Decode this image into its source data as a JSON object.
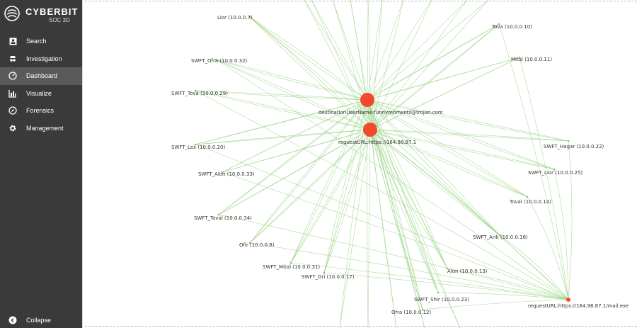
{
  "app": {
    "brand": "CYBERBIT",
    "product": "SOC 3D"
  },
  "sidebar": {
    "items": [
      {
        "label": "Search",
        "icon": "contact-card-icon"
      },
      {
        "label": "Investigation",
        "icon": "spy-icon"
      },
      {
        "label": "Dashboard",
        "icon": "speedometer-icon",
        "active": true
      },
      {
        "label": "Visualize",
        "icon": "bar-chart-icon"
      },
      {
        "label": "Forensics",
        "icon": "compass-icon"
      },
      {
        "label": "Management",
        "icon": "gear-icon"
      }
    ],
    "collapse_label": "Collapse"
  },
  "graph": {
    "edge_color": "#8fcf7a",
    "node_color": "#f24a2b",
    "hubs": [
      {
        "id": "hub1",
        "label": "destinationUserName:funnymoments@trojan.com"
      },
      {
        "id": "hub2",
        "label": "requestURL:https://164.98.87.1"
      },
      {
        "id": "hub3",
        "label": "requestURL:https://164.98.87.1/mail.exe"
      }
    ],
    "nodes": [
      {
        "id": "n1",
        "label": "Lior (10.0.0.7)"
      },
      {
        "id": "n2",
        "label": "Tova (10.0.0.10)"
      },
      {
        "id": "n3",
        "label": "Mital (10.0.0.11)"
      },
      {
        "id": "n4",
        "label": "SWFT_Ofra (10.0.0.32)"
      },
      {
        "id": "n5",
        "label": "SWFT_Tova (10.0.0.29)"
      },
      {
        "id": "n6",
        "label": "SWFT_Lex (10.0.0.20)"
      },
      {
        "id": "n7",
        "label": "SWFT_Alon (10.0.0.33)"
      },
      {
        "id": "n8",
        "label": "SWFT_Toval (10.0.0.34)"
      },
      {
        "id": "n9",
        "label": "Ofir (10.0.0.8)"
      },
      {
        "id": "n10",
        "label": "SWFT_Mital (10.0.0.31)"
      },
      {
        "id": "n11",
        "label": "SWFT_Ori (10.0.0.17)"
      },
      {
        "id": "n12",
        "label": "SWFT_Hagar (10.0.0.22)"
      },
      {
        "id": "n13",
        "label": "SWFT_Lior (10.0.0.25)"
      },
      {
        "id": "n14",
        "label": "Toval (10.0.0.14)"
      },
      {
        "id": "n15",
        "label": "SWFT_Arik (10.0.0.16)"
      },
      {
        "id": "n16",
        "label": "Alon (10.0.0.13)"
      },
      {
        "id": "n17",
        "label": "SWFT_Shir (10.0.0.23)"
      },
      {
        "id": "n18",
        "label": "Ofra (10.0.0.12)"
      }
    ]
  }
}
